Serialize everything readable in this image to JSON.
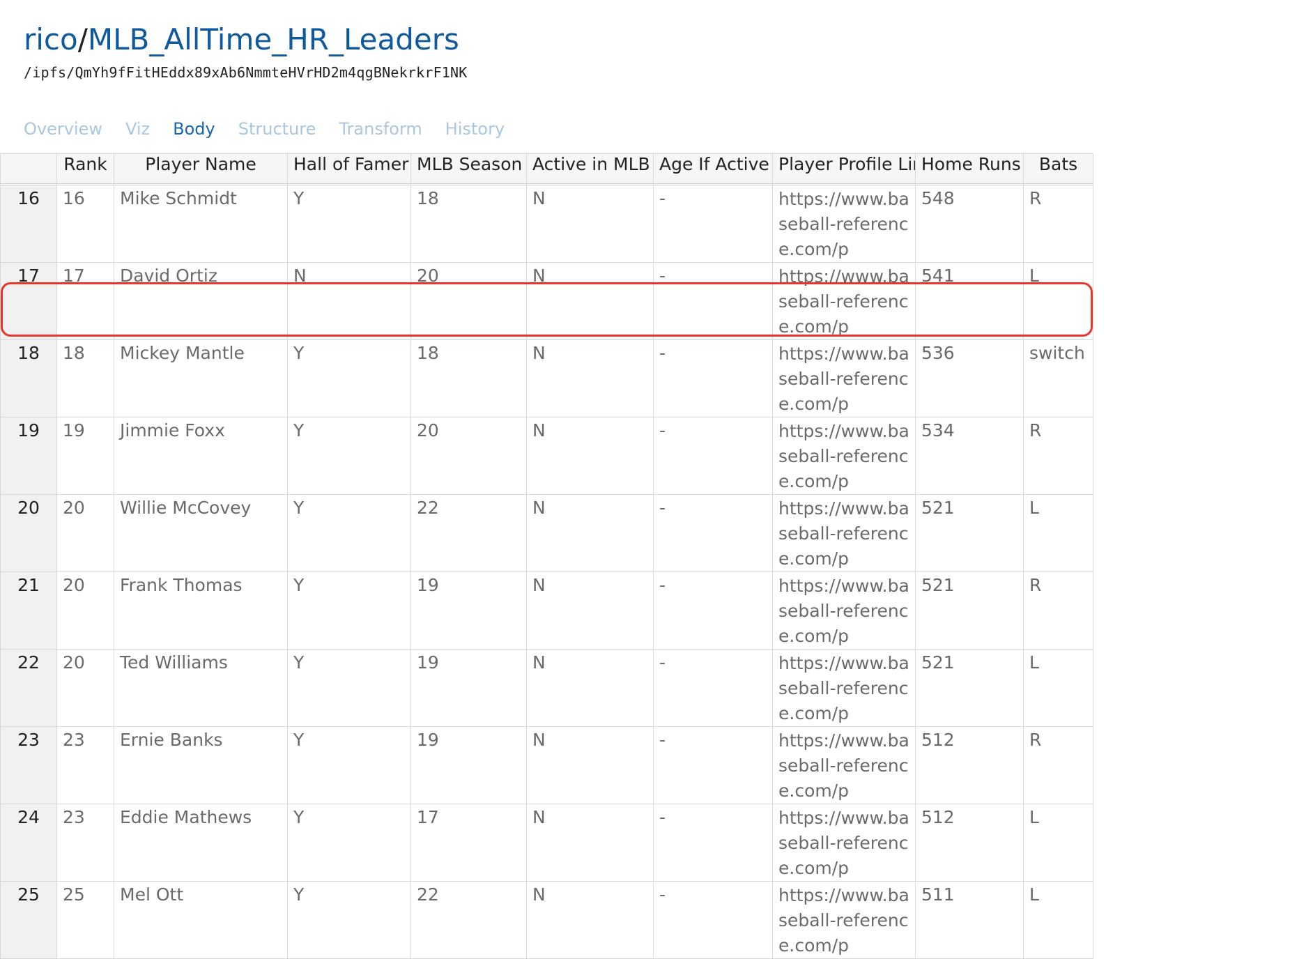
{
  "dataset": {
    "owner": "rico",
    "name": "MLB_AllTime_HR_Leaders",
    "path": "/ipfs/QmYh9fFitHEddx89xAb6NmmteHVrHD2m4qgBNekrkrF1NK"
  },
  "tabs": [
    {
      "label": "Overview",
      "active": false
    },
    {
      "label": "Viz",
      "active": false
    },
    {
      "label": "Body",
      "active": true
    },
    {
      "label": "Structure",
      "active": false
    },
    {
      "label": "Transform",
      "active": false
    },
    {
      "label": "History",
      "active": false
    }
  ],
  "table": {
    "columns": [
      "",
      "Rank",
      "Player Name",
      "Hall of Famer",
      "MLB Season",
      "Active in MLB",
      "Age If Active",
      "Player Profile Link",
      "Home Runs",
      "Bats"
    ],
    "rows": [
      [
        "16",
        "16",
        "Mike Schmidt",
        "Y",
        "18",
        "N",
        "-",
        "https://www.baseball-reference.com/p",
        "548",
        "R"
      ],
      [
        "17",
        "17",
        "David Ortiz",
        "N",
        "20",
        "N",
        "-",
        "https://www.baseball-reference.com/p",
        "541",
        "L"
      ],
      [
        "18",
        "18",
        "Mickey Mantle",
        "Y",
        "18",
        "N",
        "-",
        "https://www.baseball-reference.com/p",
        "536",
        "switch"
      ],
      [
        "19",
        "19",
        "Jimmie Foxx",
        "Y",
        "20",
        "N",
        "-",
        "https://www.baseball-reference.com/p",
        "534",
        "R"
      ],
      [
        "20",
        "20",
        "Willie McCovey",
        "Y",
        "22",
        "N",
        "-",
        "https://www.baseball-reference.com/p",
        "521",
        "L"
      ],
      [
        "21",
        "20",
        "Frank Thomas",
        "Y",
        "19",
        "N",
        "-",
        "https://www.baseball-reference.com/p",
        "521",
        "R"
      ],
      [
        "22",
        "20",
        "Ted Williams",
        "Y",
        "19",
        "N",
        "-",
        "https://www.baseball-reference.com/p",
        "521",
        "L"
      ],
      [
        "23",
        "23",
        "Ernie Banks",
        "Y",
        "19",
        "N",
        "-",
        "https://www.baseball-reference.com/p",
        "512",
        "R"
      ],
      [
        "24",
        "23",
        "Eddie Mathews",
        "Y",
        "17",
        "N",
        "-",
        "https://www.baseball-reference.com/p",
        "512",
        "L"
      ],
      [
        "25",
        "25",
        "Mel Ott",
        "Y",
        "22",
        "N",
        "-",
        "https://www.baseball-reference.com/p",
        "511",
        "L"
      ]
    ],
    "highlighted_row": "18"
  },
  "colors": {
    "link": "#0f5a9e",
    "tab_active": "#1a66a8",
    "tab_inactive": "#a9c7df",
    "highlight": "#e8352b"
  }
}
